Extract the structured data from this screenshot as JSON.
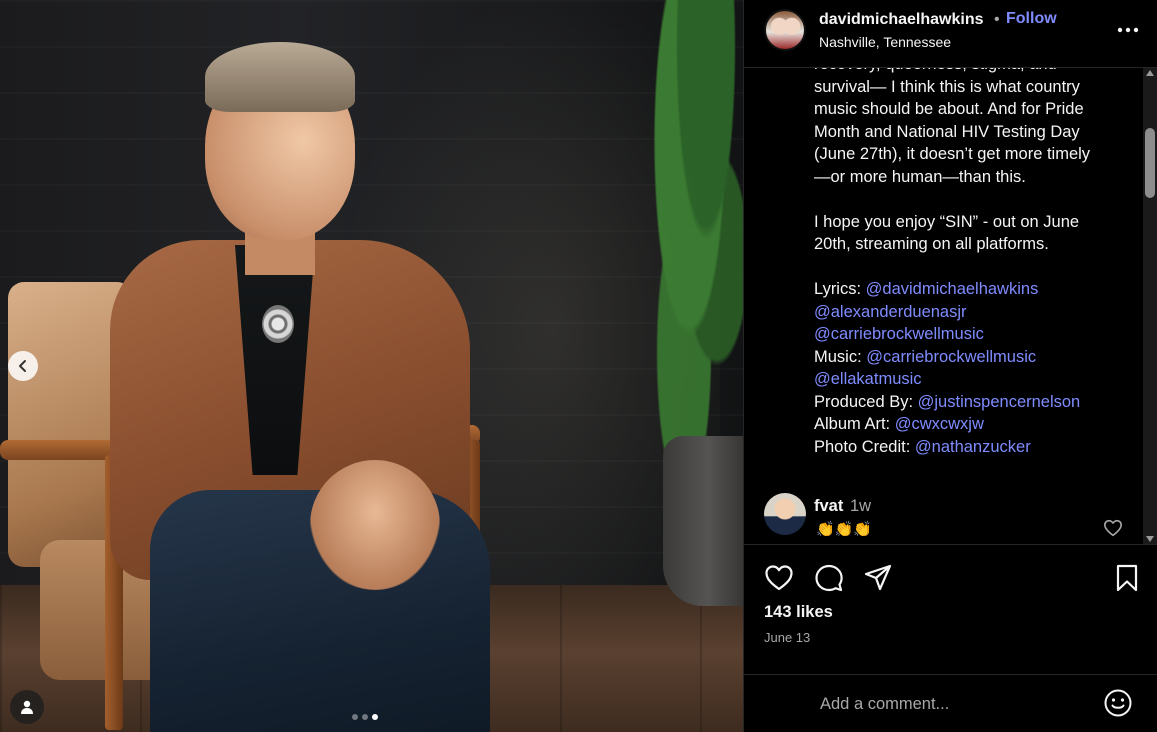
{
  "post": {
    "carousel": {
      "slide_count": 3,
      "active_slide": 3
    }
  },
  "header": {
    "username": "davidmichaelhawkins",
    "separator": "•",
    "follow_label": "Follow",
    "location": "Nashville, Tennessee"
  },
  "caption": {
    "lines": [
      {
        "text": "recovery, queerness, stigma, and",
        "mention": false
      },
      {
        "text": "survival— I think this is what country",
        "mention": false
      },
      {
        "text": "music should be about. And for Pride",
        "mention": false
      },
      {
        "text": "Month and National HIV Testing Day",
        "mention": false
      },
      {
        "text": "(June 27th), it doesn’t get more timely",
        "mention": false
      },
      {
        "text": "—or more human—than this.",
        "mention": false
      },
      {
        "text": "",
        "mention": false
      },
      {
        "text": "I hope you enjoy “SIN” - out on June",
        "mention": false
      },
      {
        "text": "20th, streaming on all platforms.",
        "mention": false
      },
      {
        "text": "",
        "mention": false
      }
    ],
    "credits": [
      {
        "label": "Lyrics: ",
        "handle": "@davidmichaelhawkins"
      },
      {
        "label": "",
        "handle": "@alexanderduenasjr"
      },
      {
        "label": "",
        "handle": "@carriebrockwellmusic"
      },
      {
        "label": "Music: ",
        "handle": "@carriebrockwellmusic"
      },
      {
        "label": "",
        "handle": "@ellakatmusic"
      },
      {
        "label": "Produced By: ",
        "handle": "@justinspencernelson"
      },
      {
        "label": "Album Art: ",
        "handle": "@cwxcwxjw"
      },
      {
        "label": "Photo Credit: ",
        "handle": "@nathanzucker"
      }
    ]
  },
  "comment": {
    "user": "fvat",
    "time": "1w",
    "text": "👏👏👏"
  },
  "stats": {
    "likes": "143 likes",
    "date": "June 13"
  },
  "add_comment": {
    "placeholder": "Add a comment..."
  },
  "colors": {
    "background": "#000000",
    "text": "#f5f5f5",
    "muted": "#a8a8a8",
    "link": "#7f8cff",
    "divider": "#262626"
  },
  "icons": [
    "chevron-left-icon",
    "user-tag-icon",
    "more-icon",
    "heart-icon",
    "comment-icon",
    "share-icon",
    "bookmark-icon",
    "emoji-icon"
  ]
}
